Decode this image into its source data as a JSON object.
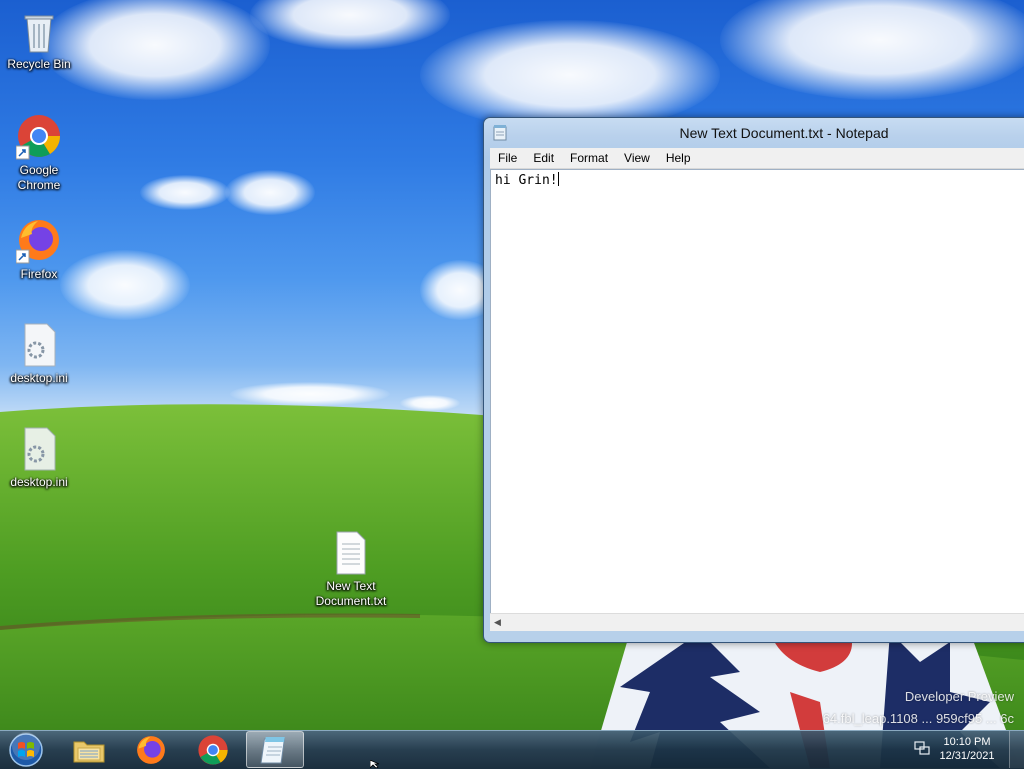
{
  "desktop": {
    "icons": [
      {
        "label": "Recycle Bin"
      },
      {
        "label": "Google Chrome"
      },
      {
        "label": "Firefox"
      },
      {
        "label": "desktop.ini"
      },
      {
        "label": "desktop.ini"
      },
      {
        "label": "New Text Document.txt"
      }
    ],
    "watermark_line1": "Developer Preview",
    "watermark_line2": "64.fbl_leap.1108 ... 959cf95 ... 6c"
  },
  "notepad": {
    "title": "New Text Document.txt - Notepad",
    "menu": [
      "File",
      "Edit",
      "Format",
      "View",
      "Help"
    ],
    "content": "hi Grin!"
  },
  "taskbar": {
    "items": [
      "start-orb-icon",
      "file-explorer-icon",
      "firefox-icon",
      "chrome-icon",
      "notepad-icon"
    ],
    "active_item": "notepad",
    "clock_time": "10:10 PM",
    "clock_date": "12/31/2021"
  },
  "colors": {
    "sky_top": "#1b5fd0",
    "grass": "#5ea82a",
    "taskbar": "#1c3446",
    "window_frame": "#b9d1ec"
  }
}
